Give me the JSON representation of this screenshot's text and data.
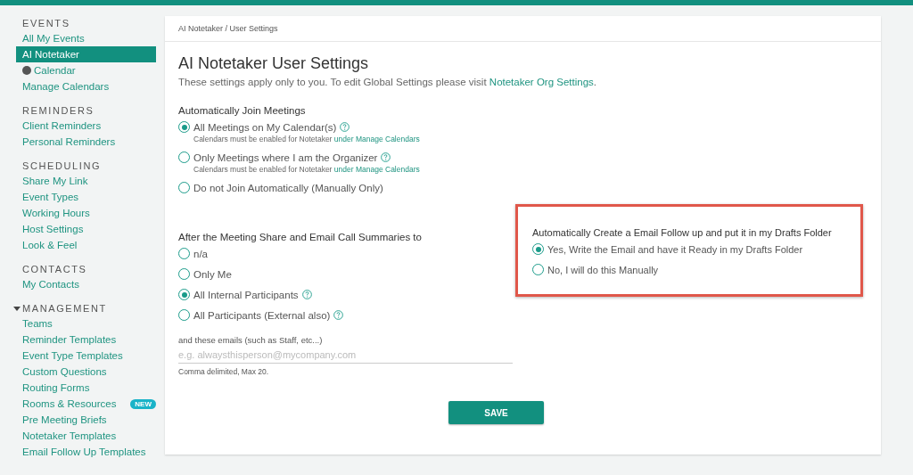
{
  "sidebar": {
    "sections": [
      {
        "title": "EVENTS",
        "items": [
          {
            "label": "All My Events",
            "selected": false,
            "kind": "link"
          },
          {
            "label": "AI Notetaker",
            "selected": true,
            "kind": "link"
          },
          {
            "label": "Calendar",
            "selected": false,
            "kind": "dot"
          },
          {
            "label": "Manage Calendars",
            "selected": false,
            "kind": "link"
          }
        ]
      },
      {
        "title": "REMINDERS",
        "items": [
          {
            "label": "Client Reminders",
            "selected": false,
            "kind": "link"
          },
          {
            "label": "Personal Reminders",
            "selected": false,
            "kind": "link"
          }
        ]
      },
      {
        "title": "SCHEDULING",
        "items": [
          {
            "label": "Share My Link",
            "selected": false,
            "kind": "link"
          },
          {
            "label": "Event Types",
            "selected": false,
            "kind": "link"
          },
          {
            "label": "Working Hours",
            "selected": false,
            "kind": "link"
          },
          {
            "label": "Host Settings",
            "selected": false,
            "kind": "link"
          },
          {
            "label": "Look & Feel",
            "selected": false,
            "kind": "link"
          }
        ]
      },
      {
        "title": "CONTACTS",
        "items": [
          {
            "label": "My Contacts",
            "selected": false,
            "kind": "link"
          }
        ]
      },
      {
        "title": "MANAGEMENT",
        "expanded": true,
        "items": [
          {
            "label": "Teams",
            "selected": false,
            "kind": "link"
          },
          {
            "label": "Reminder Templates",
            "selected": false,
            "kind": "link"
          },
          {
            "label": "Event Type Templates",
            "selected": false,
            "kind": "link"
          },
          {
            "label": "Custom Questions",
            "selected": false,
            "kind": "link"
          },
          {
            "label": "Routing Forms",
            "selected": false,
            "kind": "link"
          },
          {
            "label": "Rooms & Resources",
            "selected": false,
            "kind": "link",
            "badge": "NEW"
          },
          {
            "label": "Pre Meeting Briefs",
            "selected": false,
            "kind": "link"
          },
          {
            "label": "Notetaker Templates",
            "selected": false,
            "kind": "link"
          },
          {
            "label": "Email Follow Up Templates",
            "selected": false,
            "kind": "link"
          }
        ]
      }
    ]
  },
  "breadcrumb": "AI Notetaker / User Settings",
  "title": "AI Notetaker User Settings",
  "subtitle": {
    "text": "These settings apply only to you. To edit Global Settings please visit ",
    "link": "Notetaker Org Settings",
    "after": "."
  },
  "join": {
    "heading": "Automatically Join Meetings",
    "options": [
      {
        "label": "All Meetings on My Calendar(s)",
        "selected": true,
        "help": true,
        "note": "Calendars must be enabled for Notetaker ",
        "note_link": "under Manage Calendars"
      },
      {
        "label": "Only Meetings where I am the Organizer",
        "selected": false,
        "help": true,
        "note": "Calendars must be enabled for Notetaker ",
        "note_link": "under Manage Calendars"
      },
      {
        "label": "Do not Join Automatically (Manually Only)",
        "selected": false,
        "help": false
      }
    ]
  },
  "share": {
    "heading": "After the Meeting Share and Email Call Summaries to",
    "options": [
      {
        "label": "n/a",
        "selected": false,
        "help": false
      },
      {
        "label": "Only Me",
        "selected": false,
        "help": false
      },
      {
        "label": "All Internal Participants",
        "selected": true,
        "help": true
      },
      {
        "label": "All Participants (External also)",
        "selected": false,
        "help": true
      }
    ],
    "emails_label": "and these emails (such as Staff, etc...)",
    "emails_placeholder": "e.g. alwaysthisperson@mycompany.com",
    "emails_note": "Comma delimited, Max 20."
  },
  "followup": {
    "heading": "Automatically Create a Email Follow up and put it in my Drafts Folder",
    "highlighted": true,
    "options": [
      {
        "label": "Yes, Write the Email and have it Ready in my Drafts Folder",
        "selected": true
      },
      {
        "label": "No, I will do this Manually",
        "selected": false
      }
    ]
  },
  "save_button": "SAVE"
}
